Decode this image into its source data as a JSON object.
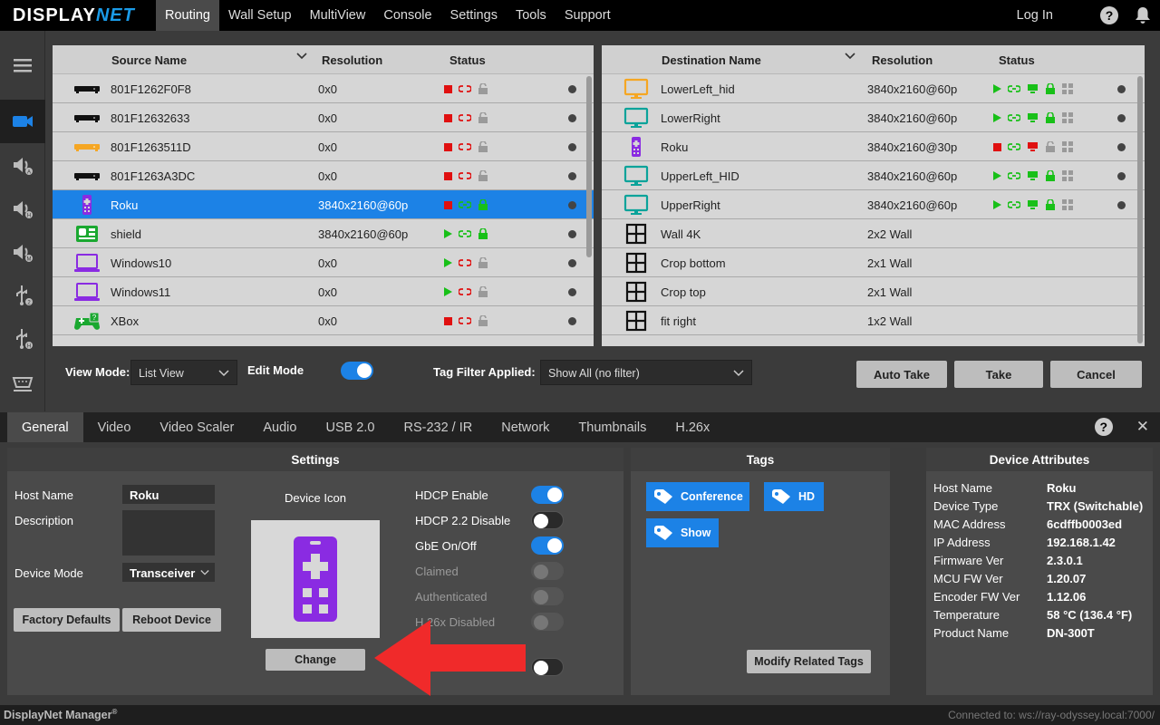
{
  "app": {
    "logo_main": "DISPLAY",
    "logo_accent": "NET",
    "name": "DisplayNet Manager",
    "name_sup": "®",
    "connection": "Connected to: ws://ray-odyssey.local:7000/"
  },
  "nav": {
    "tabs": [
      "Routing",
      "Wall Setup",
      "MultiView",
      "Console",
      "Settings",
      "Tools",
      "Support"
    ],
    "active": "Routing",
    "login": "Log In",
    "help_glyph": "?"
  },
  "sidebar": {
    "icons": [
      "menu-icon",
      "video-icon",
      "audio-a-icon",
      "audio-h-icon",
      "audio-m-icon",
      "usb-2-icon",
      "usb-h-icon",
      "serial-icon"
    ]
  },
  "source_table": {
    "headers": {
      "name": "Source Name",
      "resolution": "Resolution",
      "status": "Status"
    },
    "rows": [
      {
        "icon": "box-icon",
        "icon_color": "#111111",
        "name": "801F1262F0F8",
        "resolution": "0x0",
        "state": "stop",
        "link": "broken",
        "lock": "unlocked",
        "selected": false
      },
      {
        "icon": "box-icon",
        "icon_color": "#111111",
        "name": "801F12632633",
        "resolution": "0x0",
        "state": "stop",
        "link": "broken",
        "lock": "unlocked",
        "selected": false
      },
      {
        "icon": "box-icon",
        "icon_color": "#f5a623",
        "name": "801F1263511D",
        "resolution": "0x0",
        "state": "stop",
        "link": "broken",
        "lock": "unlocked",
        "selected": false
      },
      {
        "icon": "box-icon",
        "icon_color": "#111111",
        "name": "801F1263A3DC",
        "resolution": "0x0",
        "state": "stop",
        "link": "broken",
        "lock": "unlocked",
        "selected": false
      },
      {
        "icon": "remote-icon",
        "icon_color": "#8a2be2",
        "name": "Roku",
        "resolution": "3840x2160@60p",
        "state": "stop",
        "link": "ok",
        "lock": "locked",
        "selected": true
      },
      {
        "icon": "media-player-icon",
        "icon_color": "#1aa830",
        "name": "shield",
        "resolution": "3840x2160@60p",
        "state": "play",
        "link": "ok",
        "lock": "locked",
        "selected": false
      },
      {
        "icon": "laptop-icon",
        "icon_color": "#8a2be2",
        "name": "Windows10",
        "resolution": "0x0",
        "state": "play",
        "link": "broken",
        "lock": "unlocked",
        "selected": false
      },
      {
        "icon": "laptop-icon",
        "icon_color": "#8a2be2",
        "name": "Windows11",
        "resolution": "0x0",
        "state": "play",
        "link": "broken",
        "lock": "unlocked",
        "selected": false
      },
      {
        "icon": "gamepad-icon",
        "icon_color": "#1aa830",
        "name": "XBox",
        "resolution": "0x0",
        "state": "stop",
        "link": "broken",
        "lock": "unlocked",
        "selected": false
      }
    ]
  },
  "dest_table": {
    "headers": {
      "name": "Destination Name",
      "resolution": "Resolution",
      "status": "Status"
    },
    "rows": [
      {
        "icon": "monitor-icon",
        "icon_color": "#f5a623",
        "name": "LowerLeft_hid",
        "resolution": "3840x2160@60p",
        "status": "green"
      },
      {
        "icon": "monitor-icon",
        "icon_color": "#0aa39a",
        "name": "LowerRight",
        "resolution": "3840x2160@60p",
        "status": "green"
      },
      {
        "icon": "remote-icon",
        "icon_color": "#8a2be2",
        "name": "Roku",
        "resolution": "3840x2160@30p",
        "status": "red"
      },
      {
        "icon": "monitor-icon",
        "icon_color": "#0aa39a",
        "name": "UpperLeft_HID",
        "resolution": "3840x2160@60p",
        "status": "green"
      },
      {
        "icon": "monitor-icon",
        "icon_color": "#0aa39a",
        "name": "UpperRight",
        "resolution": "3840x2160@60p",
        "status": "green"
      },
      {
        "icon": "wall-icon",
        "icon_color": "#111111",
        "name": "Wall 4K",
        "resolution": "2x2 Wall",
        "status": "none"
      },
      {
        "icon": "wall-icon",
        "icon_color": "#111111",
        "name": "Crop bottom",
        "resolution": "2x1 Wall",
        "status": "none"
      },
      {
        "icon": "wall-icon",
        "icon_color": "#111111",
        "name": "Crop top",
        "resolution": "2x1 Wall",
        "status": "none"
      },
      {
        "icon": "wall-icon",
        "icon_color": "#111111",
        "name": "fit right",
        "resolution": "1x2 Wall",
        "status": "none"
      }
    ]
  },
  "toolbar": {
    "view_mode_label": "View Mode:",
    "view_mode_value": "List View",
    "edit_mode_label": "Edit Mode",
    "edit_mode_on": true,
    "tag_filter_label": "Tag Filter Applied:",
    "tag_filter_value": "Show All (no filter)",
    "auto_take": "Auto Take",
    "take": "Take",
    "cancel": "Cancel"
  },
  "panel_tabs": {
    "tabs": [
      "General",
      "Video",
      "Video Scaler",
      "Audio",
      "USB 2.0",
      "RS-232 / IR",
      "Network",
      "Thumbnails",
      "H.26x"
    ],
    "active": "General",
    "close_glyph": "✕"
  },
  "settings": {
    "title": "Settings",
    "host_name_label": "Host Name",
    "host_name_value": "Roku",
    "description_label": "Description",
    "description_value": "",
    "device_mode_label": "Device Mode",
    "device_mode_value": "Transceiver",
    "factory_defaults": "Factory Defaults",
    "reboot_device": "Reboot Device",
    "device_icon_label": "Device Icon",
    "change_button": "Change",
    "toggles": [
      {
        "label": "HDCP Enable",
        "on": true,
        "enabled": true
      },
      {
        "label": "HDCP 2.2 Disable",
        "on": false,
        "enabled": true
      },
      {
        "label": "GbE On/Off",
        "on": true,
        "enabled": true
      },
      {
        "label": "Claimed",
        "on": false,
        "enabled": false
      },
      {
        "label": "Authenticated",
        "on": false,
        "enabled": false
      },
      {
        "label": "H.26x Disabled",
        "on": false,
        "enabled": false
      }
    ]
  },
  "tags": {
    "title": "Tags",
    "items": [
      "Conference",
      "HD",
      "Show"
    ],
    "modify_button": "Modify Related Tags"
  },
  "attributes": {
    "title": "Device Attributes",
    "items": [
      {
        "key": "Host Name",
        "value": "Roku"
      },
      {
        "key": "Device Type",
        "value": "TRX (Switchable)"
      },
      {
        "key": "MAC Address",
        "value": "6cdffb0003ed"
      },
      {
        "key": "IP Address",
        "value": "192.168.1.42"
      },
      {
        "key": "Firmware Ver",
        "value": "2.3.0.1"
      },
      {
        "key": "MCU FW Ver",
        "value": "1.20.07"
      },
      {
        "key": "Encoder FW Ver",
        "value": "1.12.06"
      },
      {
        "key": "Temperature",
        "value": "58 °C (136.4 °F)"
      },
      {
        "key": "Product Name",
        "value": "DN-300T"
      }
    ]
  },
  "colors": {
    "accent": "#1c82e6",
    "status_red": "#e01010",
    "status_green": "#18c018",
    "annotation_arrow": "#f02a2a"
  }
}
